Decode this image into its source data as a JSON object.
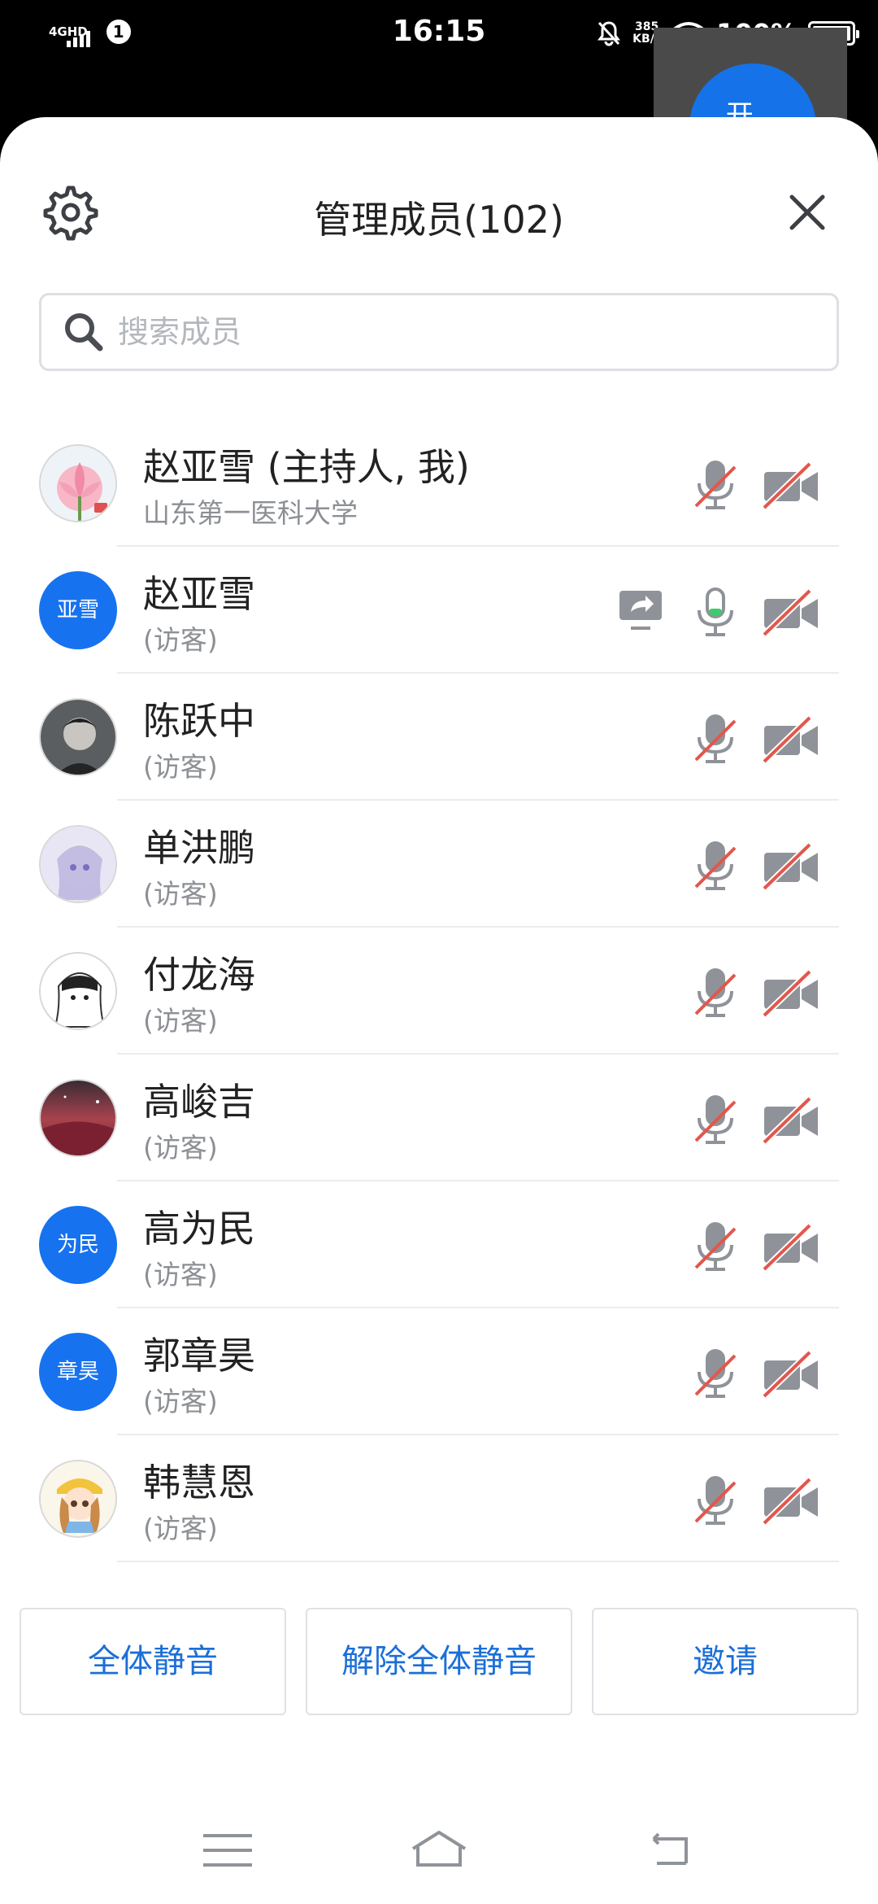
{
  "status_bar": {
    "network": "4GHD",
    "notification_count": "1",
    "time": "16:15",
    "speed_value": "385",
    "speed_unit": "KB/s",
    "battery": "100%"
  },
  "background_app": {
    "fab_label": "开..."
  },
  "header": {
    "title": "管理成员(102)"
  },
  "search": {
    "placeholder": "搜索成员"
  },
  "members": [
    {
      "name": "赵亚雪 (主持人, 我)",
      "sub": "山东第一医科大学",
      "avatar_type": "lotus-photo",
      "mic": "muted",
      "camera": "off",
      "sharing": false
    },
    {
      "name": "赵亚雪",
      "sub": "(访客)",
      "avatar_type": "text",
      "avatar_text": "亚雪",
      "mic": "on",
      "camera": "off",
      "sharing": true
    },
    {
      "name": "陈跃中",
      "sub": "(访客)",
      "avatar_type": "dark-portrait",
      "mic": "muted",
      "camera": "off",
      "sharing": false
    },
    {
      "name": "单洪鹏",
      "sub": "(访客)",
      "avatar_type": "anime-lilac",
      "mic": "muted",
      "camera": "off",
      "sharing": false
    },
    {
      "name": "付龙海",
      "sub": "(访客)",
      "avatar_type": "anime-sketch",
      "mic": "muted",
      "camera": "off",
      "sharing": false
    },
    {
      "name": "高峻吉",
      "sub": "(访客)",
      "avatar_type": "red-night-sky",
      "mic": "muted",
      "camera": "off",
      "sharing": false
    },
    {
      "name": "高为民",
      "sub": "(访客)",
      "avatar_type": "text",
      "avatar_text": "为民",
      "mic": "muted",
      "camera": "off",
      "sharing": false
    },
    {
      "name": "郭章昊",
      "sub": "(访客)",
      "avatar_type": "text",
      "avatar_text": "章昊",
      "mic": "muted",
      "camera": "off",
      "sharing": false
    },
    {
      "name": "韩慧恩",
      "sub": "(访客)",
      "avatar_type": "cartoon-girl",
      "mic": "muted",
      "camera": "off",
      "sharing": false
    }
  ],
  "actions": {
    "mute_all": "全体静音",
    "unmute_all": "解除全体静音",
    "invite": "邀请"
  },
  "colors": {
    "accent": "#1772f0",
    "action_text": "#1b6fd8",
    "muted_slash": "#e2574c",
    "icon_gray": "#8f9399",
    "mic_active": "#3ccb6d"
  }
}
